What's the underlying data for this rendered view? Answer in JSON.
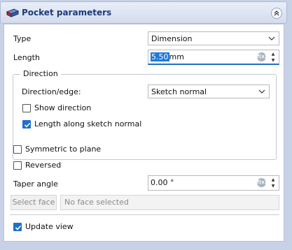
{
  "header": {
    "title": "Pocket parameters",
    "collapse_icon": "double-chevron-up-icon"
  },
  "type_row": {
    "label": "Type",
    "value": "Dimension"
  },
  "length_row": {
    "label": "Length",
    "value": "5.50",
    "unit": "mm"
  },
  "direction_group": {
    "title": "Direction",
    "edge_label": "Direction/edge:",
    "edge_value": "Sketch normal",
    "show_direction_label": "Show direction",
    "show_direction_checked": false,
    "along_normal_label": "Length along sketch normal",
    "along_normal_checked": true
  },
  "symmetric": {
    "label": "Symmetric to plane",
    "checked": false
  },
  "reversed": {
    "label": "Reversed",
    "checked": false
  },
  "taper_row": {
    "label": "Taper angle",
    "value": "0.00 °"
  },
  "face": {
    "button_label": "Select face",
    "field_text": "No face selected"
  },
  "update_view": {
    "label": "Update view",
    "checked": true
  },
  "colors": {
    "accent": "#1f6fcf",
    "header_text": "#1d3b7a"
  }
}
